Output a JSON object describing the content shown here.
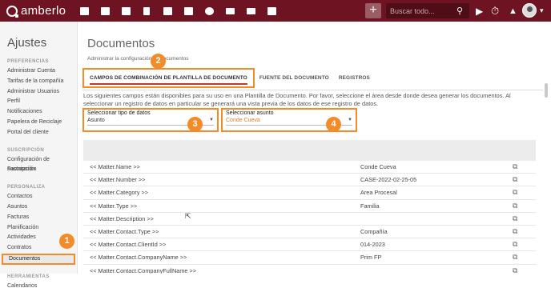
{
  "app": {
    "logo_text": "amberlo"
  },
  "topbar": {
    "nav_icons": [
      "dashboard-icon",
      "contacts-icon",
      "matters-icon",
      "documents-icon",
      "billing-icon",
      "calendar-icon",
      "time-icon",
      "folder-icon",
      "email-icon",
      "image-icon"
    ],
    "plus_label": "+",
    "search_placeholder": "Buscar todo...",
    "search_icon": "search-icon",
    "play_icon": "▶",
    "timer_icon": "⏱",
    "bell_icon": "🔔",
    "user_caret": "▾"
  },
  "sidebar": {
    "title": "Ajustes",
    "sections": [
      {
        "header": "PREFERENCIAS",
        "items": [
          "Administrar Cuenta",
          "Tarifas de la compañía",
          "Administrar Usuarios",
          "Perfil",
          "Notificaciones",
          "Papelera de Reciclaje",
          "Portal del cliente"
        ]
      },
      {
        "header": "SUSCRIPCIÓN",
        "items": [
          "Configuración de suscripción",
          "Facturación"
        ]
      },
      {
        "header": "PERSONALIZA",
        "items": [
          "Contactos",
          "Asuntos",
          "Facturas",
          "Planificación",
          "Actividades",
          "Contratos",
          "Documentos"
        ]
      },
      {
        "header": "HERRAMIENTAS",
        "items": [
          "Calendarios"
        ]
      }
    ],
    "active_item": "Documentos"
  },
  "main": {
    "title": "Documentos",
    "breadcrumb": "Administrar la configuración de documentos",
    "tabs": [
      "CAMPOS DE COMBINACIÓN DE PLANTILLA DE DOCUMENTO",
      "FUENTE DEL DOCUMENTO",
      "REGISTROS"
    ],
    "description": "Los siguientes campos están disponibles para su uso en una Plantilla de Documento. Por favor, seleccione el área desde donde desea generar los documentos. Al seleccionar un registro de datos en particular se generará una vista previa de los datos de ese registro de datos.",
    "data_type": {
      "label": "Seleccionar tipo de datos",
      "value": "Asunto"
    },
    "matter": {
      "label": "Seleccionar asunto",
      "value": "Conde Cueva"
    },
    "rows": [
      {
        "field": "<< Matter.Name >>",
        "value": "Conde Cueva"
      },
      {
        "field": "<< Matter.Number >>",
        "value": "CASE-2022-02-25-05"
      },
      {
        "field": "<< Matter.Category >>",
        "value": "Area Procesal"
      },
      {
        "field": "<< Matter.Type >>",
        "value": "Familia"
      },
      {
        "field": "<< Matter.Description >>",
        "value": ""
      },
      {
        "field": "<< Matter.Contact.Type >>",
        "value": "Compañía"
      },
      {
        "field": "<< Matter.Contact.ClientId >>",
        "value": "014-2023"
      },
      {
        "field": "<< Matter.Contact.CompanyName >>",
        "value": "Prim FP"
      },
      {
        "field": "<< Matter.Contact.CompanyFullName >>",
        "value": ""
      }
    ]
  },
  "annotations": [
    "1",
    "2",
    "3",
    "4"
  ],
  "colors": {
    "topbar": "#6e1321",
    "highlight": "#f28c28",
    "accent_text": "#e07a2e"
  }
}
